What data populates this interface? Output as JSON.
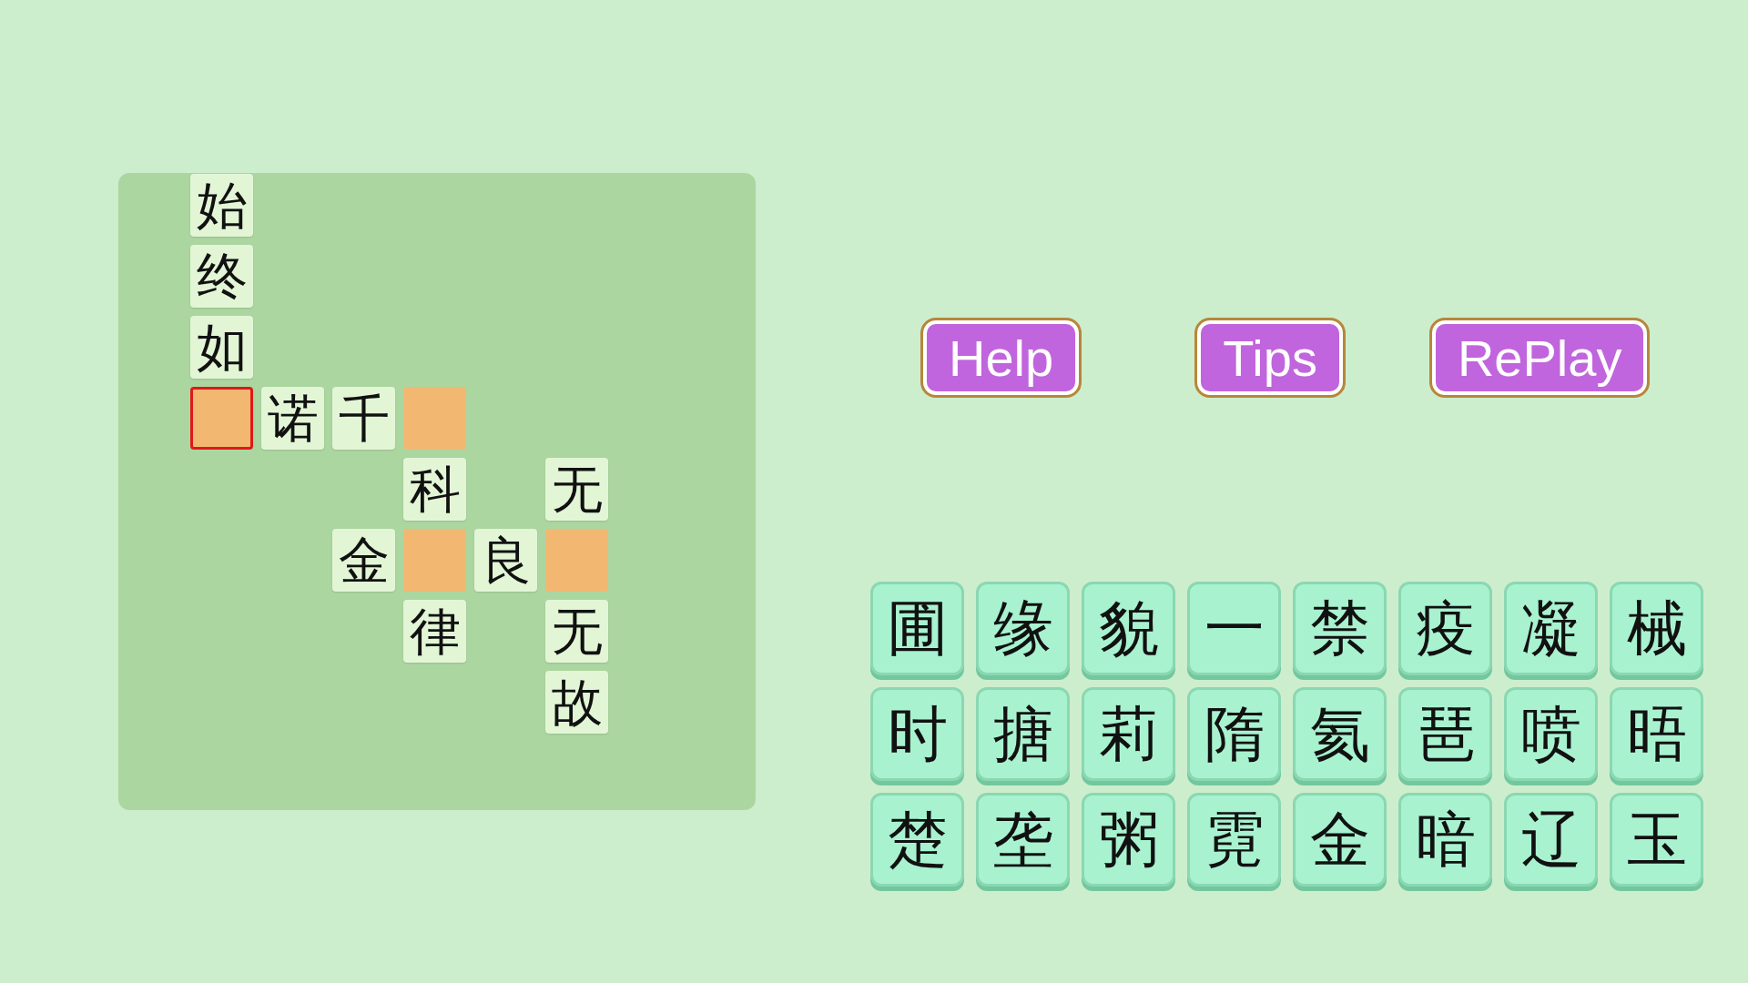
{
  "board": {
    "rows": [
      [
        {
          "kind": "space"
        },
        {
          "kind": "letter",
          "text": "始",
          "selected": false
        }
      ],
      [
        {
          "kind": "space"
        },
        {
          "kind": "letter",
          "text": "终",
          "selected": false
        }
      ],
      [
        {
          "kind": "space"
        },
        {
          "kind": "letter",
          "text": "如",
          "selected": false
        }
      ],
      [
        {
          "kind": "space"
        },
        {
          "kind": "blank",
          "selected": true
        },
        {
          "kind": "letter",
          "text": "诺",
          "selected": false
        },
        {
          "kind": "letter",
          "text": "千",
          "selected": false
        },
        {
          "kind": "blank",
          "selected": false
        }
      ],
      [
        {
          "kind": "space"
        },
        {
          "kind": "space"
        },
        {
          "kind": "space"
        },
        {
          "kind": "space"
        },
        {
          "kind": "letter",
          "text": "科",
          "selected": false
        },
        {
          "kind": "space"
        },
        {
          "kind": "letter",
          "text": "无",
          "selected": false
        }
      ],
      [
        {
          "kind": "space"
        },
        {
          "kind": "space"
        },
        {
          "kind": "space"
        },
        {
          "kind": "letter",
          "text": "金",
          "selected": false
        },
        {
          "kind": "blank",
          "selected": false
        },
        {
          "kind": "letter",
          "text": "良",
          "selected": false
        },
        {
          "kind": "blank",
          "selected": false
        }
      ],
      [
        {
          "kind": "space"
        },
        {
          "kind": "space"
        },
        {
          "kind": "space"
        },
        {
          "kind": "space"
        },
        {
          "kind": "letter",
          "text": "律",
          "selected": false
        },
        {
          "kind": "space"
        },
        {
          "kind": "letter",
          "text": "无",
          "selected": false
        }
      ],
      [
        {
          "kind": "space"
        },
        {
          "kind": "space"
        },
        {
          "kind": "space"
        },
        {
          "kind": "space"
        },
        {
          "kind": "space"
        },
        {
          "kind": "space"
        },
        {
          "kind": "letter",
          "text": "故",
          "selected": false
        }
      ]
    ]
  },
  "buttons": [
    "Help",
    "Tips",
    "RePlay"
  ],
  "tiles": [
    "圃",
    "缘",
    "貌",
    "一",
    "禁",
    "疫",
    "凝",
    "械",
    "时",
    "搪",
    "莉",
    "隋",
    "氦",
    "琶",
    "喷",
    "晤",
    "楚",
    "垄",
    "粥",
    "霓",
    "金",
    "暗",
    "辽",
    "玉"
  ]
}
